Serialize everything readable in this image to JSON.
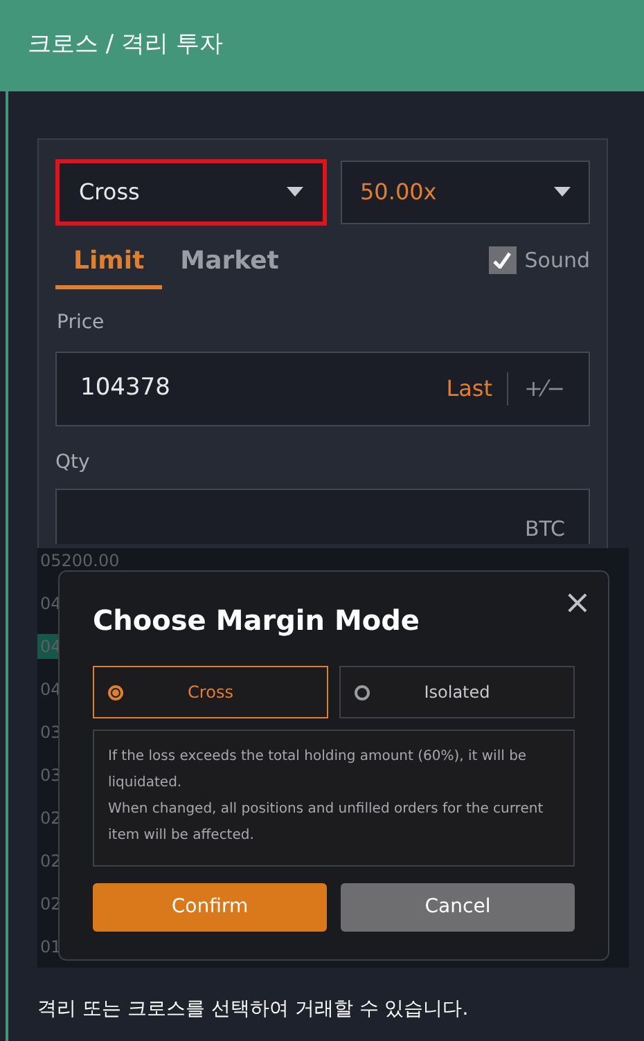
{
  "header": {
    "title": "크로스 / 격리 투자"
  },
  "order_form": {
    "margin_select": {
      "value": "Cross",
      "highlighted": true
    },
    "leverage_select": {
      "value": "50.00x"
    },
    "tabs": [
      {
        "label": "Limit",
        "selected": true
      },
      {
        "label": "Market",
        "selected": false
      }
    ],
    "sound": {
      "label": "Sound",
      "checked": true
    },
    "price": {
      "label": "Price",
      "value": "104378",
      "last": "Last",
      "adjust": "+⁄−"
    },
    "qty": {
      "label": "Qty",
      "unit": "BTC"
    }
  },
  "order_book_prices": [
    "05200.00",
    "04",
    "04",
    "04",
    "03",
    "03",
    "02",
    "02",
    "02",
    "01"
  ],
  "dialog": {
    "title": "Choose Margin Mode",
    "close": "×",
    "options": [
      {
        "label": "Cross",
        "selected": true
      },
      {
        "label": "Isolated",
        "selected": false
      }
    ],
    "description": [
      "If the loss exceeds the total holding amount (60%), it will be liquidated.",
      "When changed, all positions and unfilled orders for the current item will be affected."
    ],
    "buttons": [
      {
        "label": "Confirm",
        "kind": "primary"
      },
      {
        "label": "Cancel",
        "kind": "secondary"
      }
    ]
  },
  "caption": "격리 또는 크로스를 선택하여 거래할 수 있습니다."
}
